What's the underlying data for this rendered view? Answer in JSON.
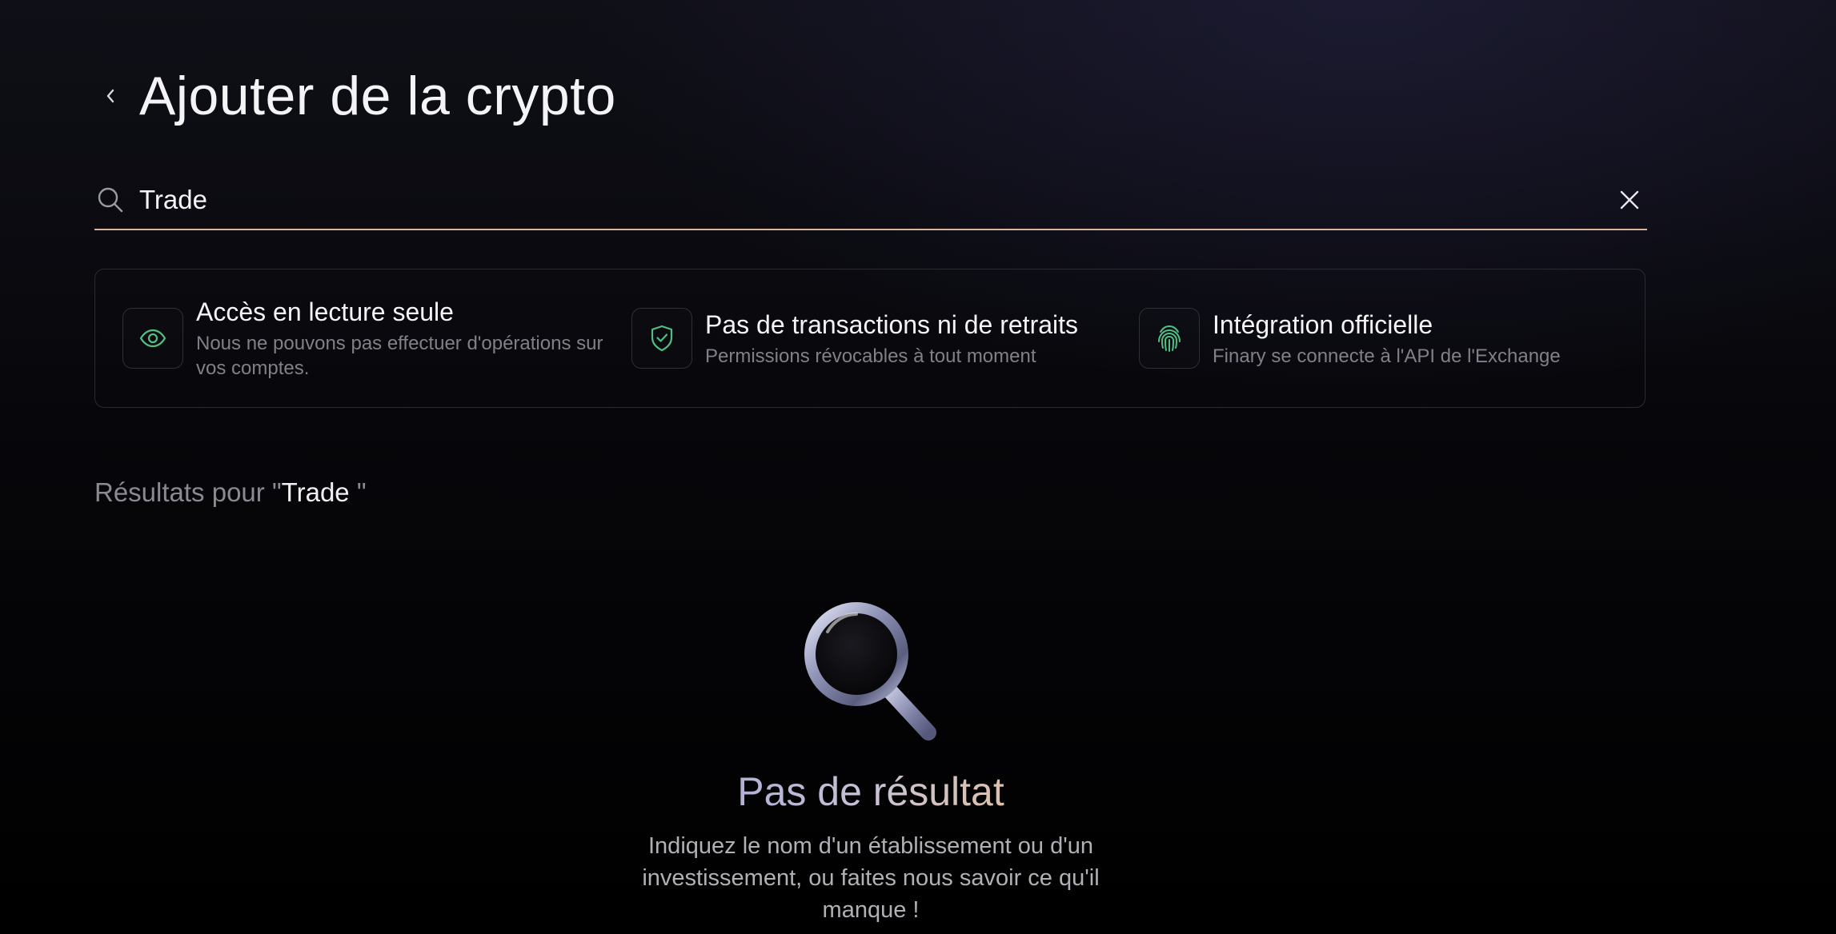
{
  "header": {
    "title": "Ajouter de la crypto",
    "back_icon": "chevron-left-icon"
  },
  "search": {
    "value": "Trade",
    "placeholder": "",
    "search_icon": "search-icon",
    "clear_icon": "close-icon",
    "accent_color": "#d9b49b"
  },
  "features": [
    {
      "icon": "eye-icon",
      "title": "Accès en lecture seule",
      "description": "Nous ne pouvons pas effectuer d'opérations sur vos comptes."
    },
    {
      "icon": "shield-check-icon",
      "title": "Pas de transactions ni de retraits",
      "description": "Permissions révocables à tout moment"
    },
    {
      "icon": "fingerprint-icon",
      "title": "Intégration officielle",
      "description": "Finary se connecte à l'API de l'Exchange"
    }
  ],
  "feature_icon_color": "#4fbf86",
  "results": {
    "prefix": "Résultats pour \"",
    "query": "Trade",
    "suffix": " \""
  },
  "empty_state": {
    "icon": "magnifier-illustration",
    "title": "Pas de résultat",
    "description": "Indiquez le nom d'un établissement ou d'un investissement, ou faites nous savoir ce qu'il manque !"
  }
}
